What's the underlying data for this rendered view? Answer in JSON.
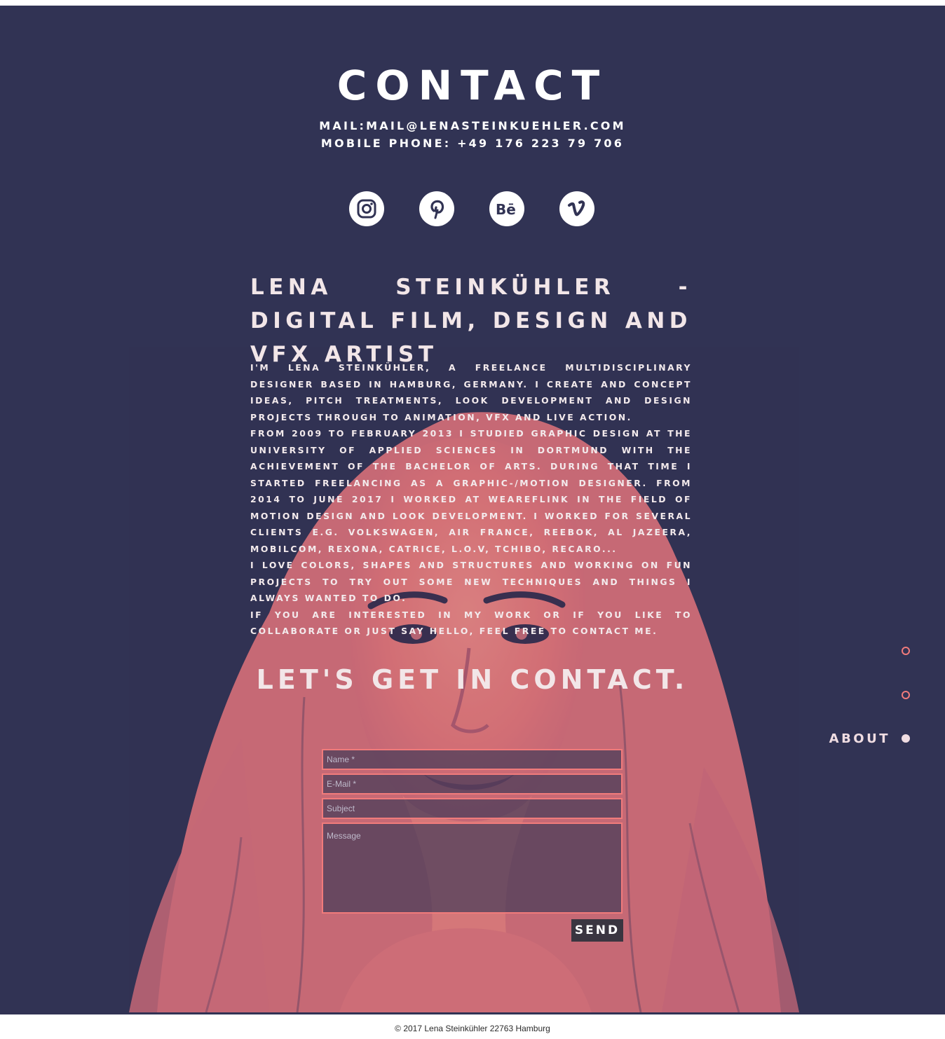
{
  "contact": {
    "title": "Contact",
    "mail": "Mail:mail@lenasteinkuehler.com",
    "phone": "Mobile Phone: +49 176 223 79 706"
  },
  "social": [
    {
      "name": "Instagram",
      "icon": "instagram-icon"
    },
    {
      "name": "Pinterest",
      "icon": "pinterest-icon"
    },
    {
      "name": "Behance",
      "icon": "behance-icon"
    },
    {
      "name": "Vimeo",
      "icon": "vimeo-icon"
    }
  ],
  "about": {
    "headline": "Lena Steinkühler - Digital Film, Design and VFX Artist",
    "paragraphs": [
      "I'm Lena Steinkühler, a freelance multidisciplinary designer based in Hamburg, Germany. I create and concept ideas, pitch treatments, look development and design projects through to animation, VFX and live action.",
      "From 2009 to February 2013 I studied graphic design at the University of Applied Sciences in Dortmund with the achievement of the Bachelor of Arts. During that time I started freelancing as a graphic-/motion designer. From 2014 to June 2017 I worked at WeAreFlink in the field of motion design and look development. I worked  for several clients e.g. Volkswagen, Air France, Reebok, Al Jazeera, mobilcom, Rexona, Catrice, L.O.V, Tchibo, Recaro...",
      "I love colors, shapes and structures and working on fun projects to try out some new techniques and things I always wanted to do.",
      "If you are interested in my work or if you like to collaborate or just say hello, feel free to contact me."
    ]
  },
  "form": {
    "heading": "Let's get in contact.",
    "name_placeholder": "Name *",
    "email_placeholder": "E-Mail *",
    "subject_placeholder": "Subject",
    "message_placeholder": "Message",
    "send_label": "Send"
  },
  "nav": {
    "active_label": "About"
  },
  "footer": {
    "text": "© 2017 Lena Steinkühler 22763 Hamburg"
  },
  "colors": {
    "background": "#313354",
    "accent": "#f17b7b",
    "text": "#ffffff"
  }
}
